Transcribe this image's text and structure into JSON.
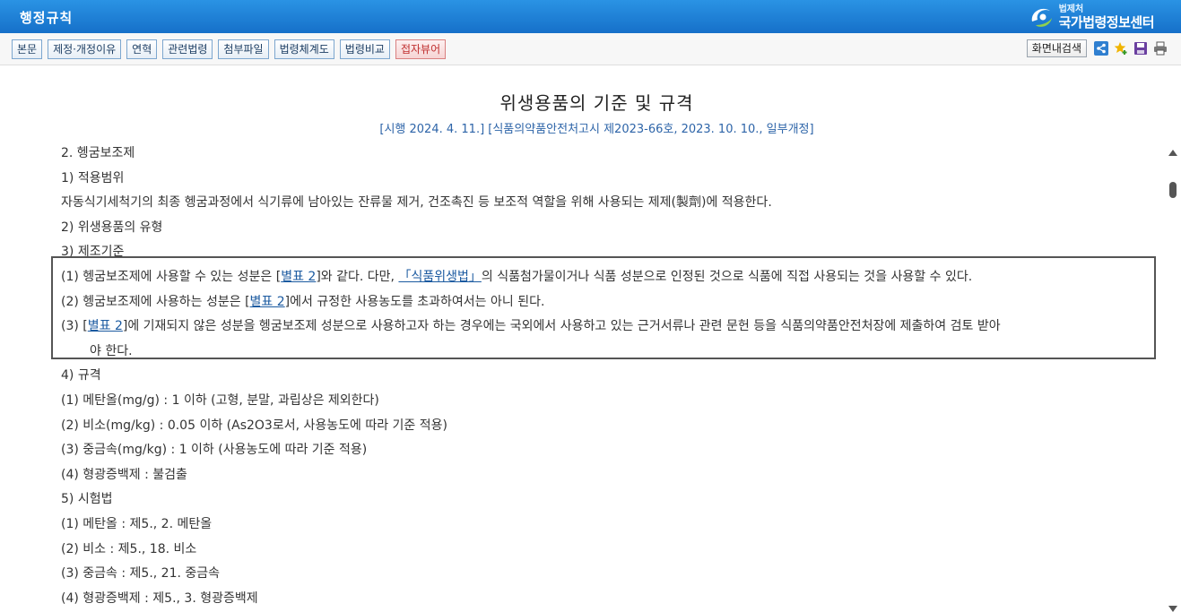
{
  "header": {
    "app_title": "행정규칙",
    "brand_small": "법제처",
    "brand_large": "국가법령정보센터"
  },
  "toolbar": {
    "tabs": [
      "본문",
      "제정·개정이유",
      "연혁",
      "관련법령",
      "첨부파일",
      "법령체계도",
      "법령비교",
      "접자뷰어"
    ],
    "search_label": "화면내검색",
    "icons": [
      "share-icon",
      "favorite-add-icon",
      "save-icon",
      "print-icon"
    ]
  },
  "document": {
    "title": "위생용품의 기준 및 규격",
    "meta": "[시행 2024. 4. 11.] [식품의약품안전처고시 제2023-66호, 2023. 10. 10., 일부개정]",
    "lines": [
      "2. 헹굼보조제",
      "1) 적용범위",
      "자동식기세척기의 최종 헹굼과정에서 식기류에 남아있는 잔류물 제거, 건조촉진 등 보조적 역할을 위해 사용되는 제제(製劑)에 적용한다.",
      "2) 위생용품의 유형",
      "3) 제조기준"
    ],
    "p1_a": "(1) 헹굼보조제에 사용할 수 있는 성분은 [",
    "p1_link": "별표 2",
    "p1_b": "]와 같다. 다만, ",
    "p1_law": "「식품위생법」",
    "p1_c": "의 식품첨가물이거나 식품 성분으로 인정된 것으로 식품에 직접 사용되는 것을 사용할 수 있다.",
    "p2_a": "(2) 헹굼보조제에 사용하는 성분은 [",
    "p2_link": "별표 2",
    "p2_b": "]에서 규정한 사용농도를 초과하여서는 아니 된다.",
    "p3_a": "(3) [",
    "p3_link": "별표 2",
    "p3_b": "]에 기재되지 않은 성분을 헹굼보조제 성분으로 사용하고자 하는 경우에는 국외에서 사용하고 있는 근거서류나 관련 문헌 등을 식품의약품안전처장에 제출하여 검토 받아",
    "p3_c": "야 한다.",
    "lines_after": [
      "4) 규격",
      "(1) 메탄올(mg/g) : 1 이하 (고형, 분말, 과립상은 제외한다)",
      "(2) 비소(mg/kg) : 0.05 이하 (As2O3로서, 사용농도에 따라 기준 적용)",
      "(3) 중금속(mg/kg) : 1 이하 (사용농도에 따라 기준 적용)",
      "(4) 형광증백제 : 불검출",
      "5) 시험법",
      "(1) 메탄올 : 제5., 2. 메탄올",
      "(2) 비소 : 제5., 18. 비소",
      "(3) 중금속 : 제5., 21. 중금속",
      "(4) 형광증백제 : 제5., 3. 형광증백제"
    ]
  },
  "colors": {
    "header_blue": "#1670c9",
    "link_blue": "#1b5aa0",
    "meta_blue": "#2d64a8",
    "tab_red": "#c03030"
  }
}
